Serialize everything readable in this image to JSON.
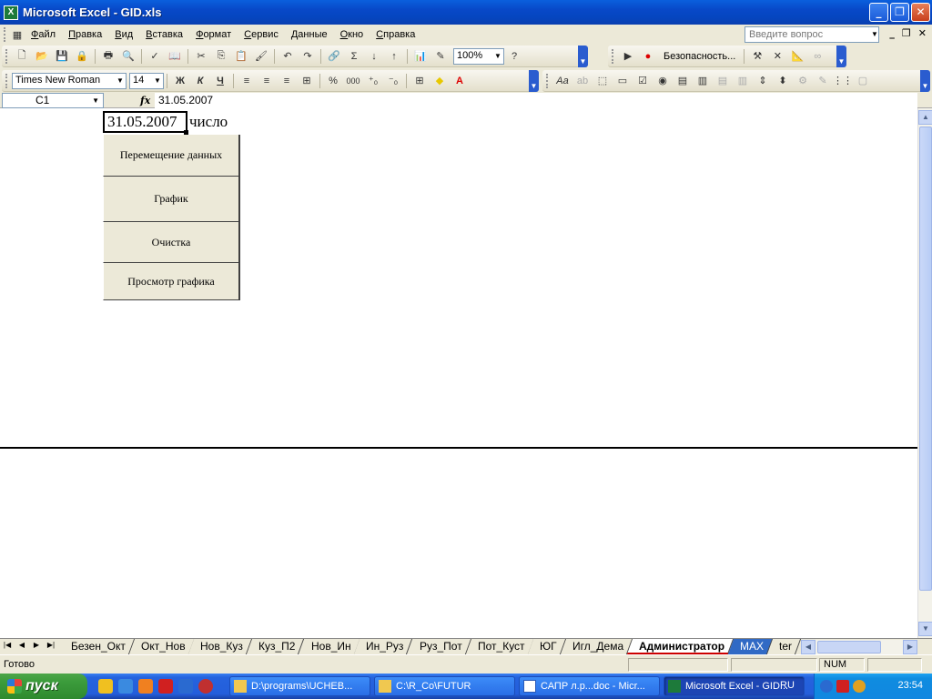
{
  "window": {
    "title": "Microsoft Excel - GID.xls",
    "app_icon": "X",
    "controls": [
      "minimize-icon",
      "restore-icon",
      "close-icon"
    ]
  },
  "menubar": {
    "items": [
      "Файл",
      "Правка",
      "Вид",
      "Вставка",
      "Формат",
      "Сервис",
      "Данные",
      "Окно",
      "Справка"
    ],
    "help_placeholder": "Введите вопрос"
  },
  "toolbar_standard": {
    "zoom": "100%"
  },
  "toolbar_vb": {
    "security_label": "Безопасность..."
  },
  "toolbar_format": {
    "font_name": "Times New Roman",
    "font_size": "14",
    "bold": "Ж",
    "italic": "К",
    "underline": "Ч",
    "percent": "%",
    "thousands": "000"
  },
  "formula_bar": {
    "name_box": "C1",
    "fx": "fx",
    "value": "31.05.2007"
  },
  "sheet": {
    "c1_value": "31.05.2007",
    "d1_value": "число",
    "buttons": [
      "Перемещение данных",
      "График",
      "Очистка",
      "Просмотр графика"
    ]
  },
  "tabs": {
    "items": [
      "Безен_Окт",
      "Окт_Нов",
      "Нов_Куз",
      "Куз_П2",
      "Нов_Ин",
      "Ин_Руз",
      "Руз_Пот",
      "Пот_Куст",
      "ЮГ",
      "Игл_Дема",
      "Администратор",
      "MAX",
      "ter"
    ],
    "active_index": 10,
    "selected_index": 11
  },
  "statusbar": {
    "ready": "Готово",
    "num": "NUM"
  },
  "taskbar": {
    "start_label": "пуск",
    "tasks": [
      "D:\\programs\\UCHEB...",
      "C:\\R_Co\\FUTUR",
      "САПР л.р...doc - Micr...",
      "Microsoft Excel - GID..."
    ],
    "lang": "RU",
    "clock": "23:54"
  },
  "colors": {
    "titlebar": "#0a5fdd",
    "chrome": "#ece9d8",
    "taskbar": "#245edb",
    "start": "#3c9c3c"
  }
}
